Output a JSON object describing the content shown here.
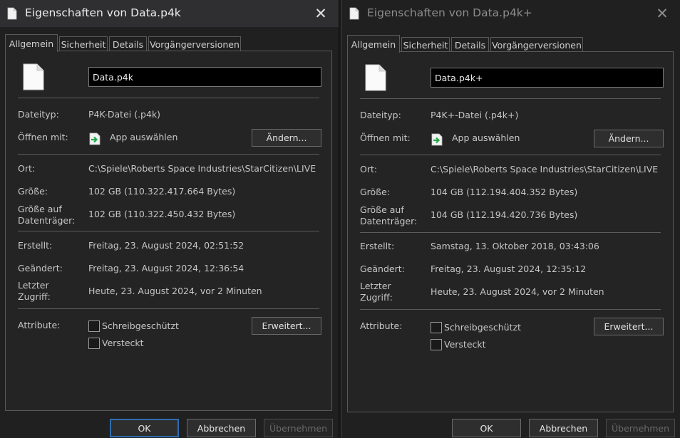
{
  "dialogs": [
    {
      "title": "Eigenschaften von Data.p4k",
      "tabs": [
        "Allgemein",
        "Sicherheit",
        "Details",
        "Vorgängerversionen"
      ],
      "filename": "Data.p4k",
      "type_label": "Dateityp:",
      "type_value": "P4K-Datei (.p4k)",
      "openwith_label": "Öffnen mit:",
      "openwith_value": "App auswählen",
      "change_button": "Ändern...",
      "location_label": "Ort:",
      "location_value": "C:\\Spiele\\Roberts Space Industries\\StarCitizen\\LIVE",
      "size_label": "Größe:",
      "size_value": "102 GB (110.322.417.664 Bytes)",
      "disksize_label": "Größe auf\nDatenträger:",
      "disksize_value": "102 GB (110.322.450.432 Bytes)",
      "created_label": "Erstellt:",
      "created_value": "Freitag, 23. August 2024, 02:51:52",
      "modified_label": "Geändert:",
      "modified_value": "Freitag, 23. August 2024, 12:36:54",
      "accessed_label": "Letzter\nZugriff:",
      "accessed_value": "Heute, 23. August 2024, vor 2 Minuten",
      "attributes_label": "Attribute:",
      "readonly_label": "Schreibgeschützt",
      "hidden_label": "Versteckt",
      "advanced_button": "Erweitert...",
      "ok_button": "OK",
      "cancel_button": "Abbrechen",
      "apply_button": "Übernehmen",
      "readonly_checked": false,
      "hidden_checked": false
    },
    {
      "title": "Eigenschaften von Data.p4k+",
      "tabs": [
        "Allgemein",
        "Sicherheit",
        "Details",
        "Vorgängerversionen"
      ],
      "filename": "Data.p4k+",
      "type_label": "Dateityp:",
      "type_value": "P4K+-Datei (.p4k+)",
      "openwith_label": "Öffnen mit:",
      "openwith_value": "App auswählen",
      "change_button": "Ändern...",
      "location_label": "Ort:",
      "location_value": "C:\\Spiele\\Roberts Space Industries\\StarCitizen\\LIVE",
      "size_label": "Größe:",
      "size_value": "104 GB (112.194.404.352 Bytes)",
      "disksize_label": "Größe auf\nDatenträger:",
      "disksize_value": "104 GB (112.194.420.736 Bytes)",
      "created_label": "Erstellt:",
      "created_value": "Samstag, 13. Oktober 2018, 03:43:06",
      "modified_label": "Geändert:",
      "modified_value": "Freitag, 23. August 2024, 12:35:12",
      "accessed_label": "Letzter\nZugriff:",
      "accessed_value": "Heute, 23. August 2024, vor 2 Minuten",
      "attributes_label": "Attribute:",
      "readonly_label": "Schreibgeschützt",
      "hidden_label": "Versteckt",
      "advanced_button": "Erweitert...",
      "ok_button": "OK",
      "cancel_button": "Abbrechen",
      "apply_button": "Übernehmen",
      "readonly_checked": false,
      "hidden_checked": false
    }
  ],
  "colors": {
    "dialog_bg": "#202020",
    "panel_bg": "#242424",
    "active_titlebar": "#2f2f31",
    "accent_border": "#2f6cae",
    "open_with_arrow": "#1fa84a"
  },
  "icons": {
    "title": "document-icon",
    "file": "blank-file-icon",
    "open_with": "open-with-app-icon",
    "close": "close-icon"
  }
}
